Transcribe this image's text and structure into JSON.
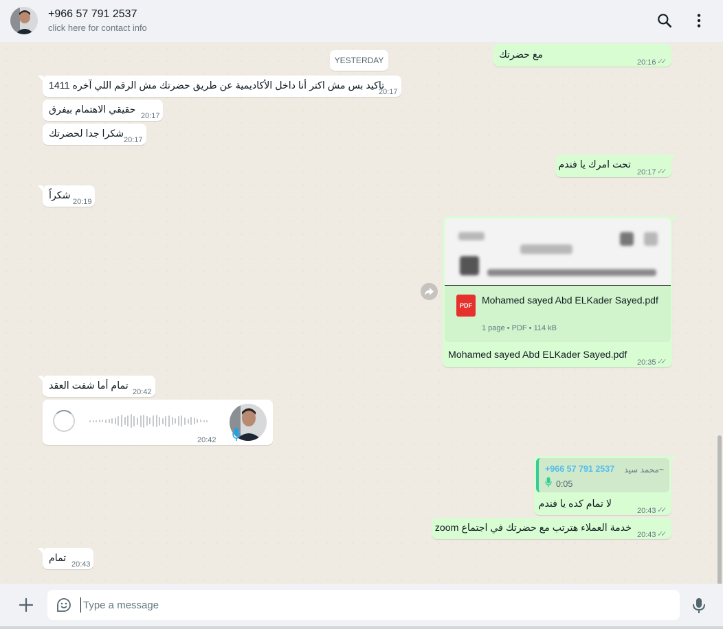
{
  "header": {
    "contact_name": "+966 57 791 2537",
    "contact_subtitle": "click here for contact info",
    "icons": [
      "avatar",
      "search-icon",
      "menu-icon"
    ]
  },
  "chat": {
    "date_divider": "YESTERDAY",
    "messages": [
      {
        "dir": "out",
        "text": "مع حضرتك",
        "time": "20:16",
        "status": "read"
      },
      {
        "dir": "in",
        "text": "تاكيد بس مش اكتر أنا داخل الأكاديمية عن طريق حضرتك مش الرقم اللي آخره 1411",
        "time": "20:17"
      },
      {
        "dir": "in",
        "text": "حقيقي الاهتمام بيفرق",
        "time": "20:17"
      },
      {
        "dir": "in",
        "text": "شكرا جدا لحضرتك",
        "time": "20:17"
      },
      {
        "dir": "out",
        "text": "تحت امرك يا فندم",
        "time": "20:17",
        "status": "read"
      },
      {
        "dir": "in",
        "text": "شكراً",
        "time": "20:19"
      },
      {
        "dir": "out",
        "type": "document",
        "file_name": "Mohamed sayed Abd ELKader Sayed.pdf",
        "file_meta": "1 page • PDF • 114 kB",
        "badge": "PDF",
        "caption": "Mohamed sayed Abd ELKader Sayed.pdf",
        "time": "20:35",
        "status": "read"
      },
      {
        "dir": "in",
        "text": "تمام أما شفت العقد",
        "time": "20:42"
      },
      {
        "dir": "in",
        "type": "voice",
        "time": "20:42"
      },
      {
        "dir": "out",
        "type": "reply",
        "quoted_author": "+966 57 791 2537",
        "quoted_push_name": "~محمد سيد",
        "quoted_duration": "0:05",
        "text": "لا تمام كده يا فندم",
        "time": "20:43",
        "status": "read"
      },
      {
        "dir": "out",
        "text": "خدمة العملاء هترتب مع حضرتك في اجتماع zoom",
        "time": "20:43",
        "status": "read"
      },
      {
        "dir": "in",
        "text": "تمام",
        "time": "20:43"
      }
    ]
  },
  "composer": {
    "placeholder": "Type a message",
    "value": ""
  },
  "colors": {
    "outgoing_bubble": "#d9fdd3",
    "incoming_bubble": "#ffffff",
    "chat_background": "#efeae2",
    "read_ticks": "#8696a0",
    "pdf_badge": "#e5322d",
    "quote_accent": "#35cd96",
    "quote_author": "#53bdeb"
  }
}
